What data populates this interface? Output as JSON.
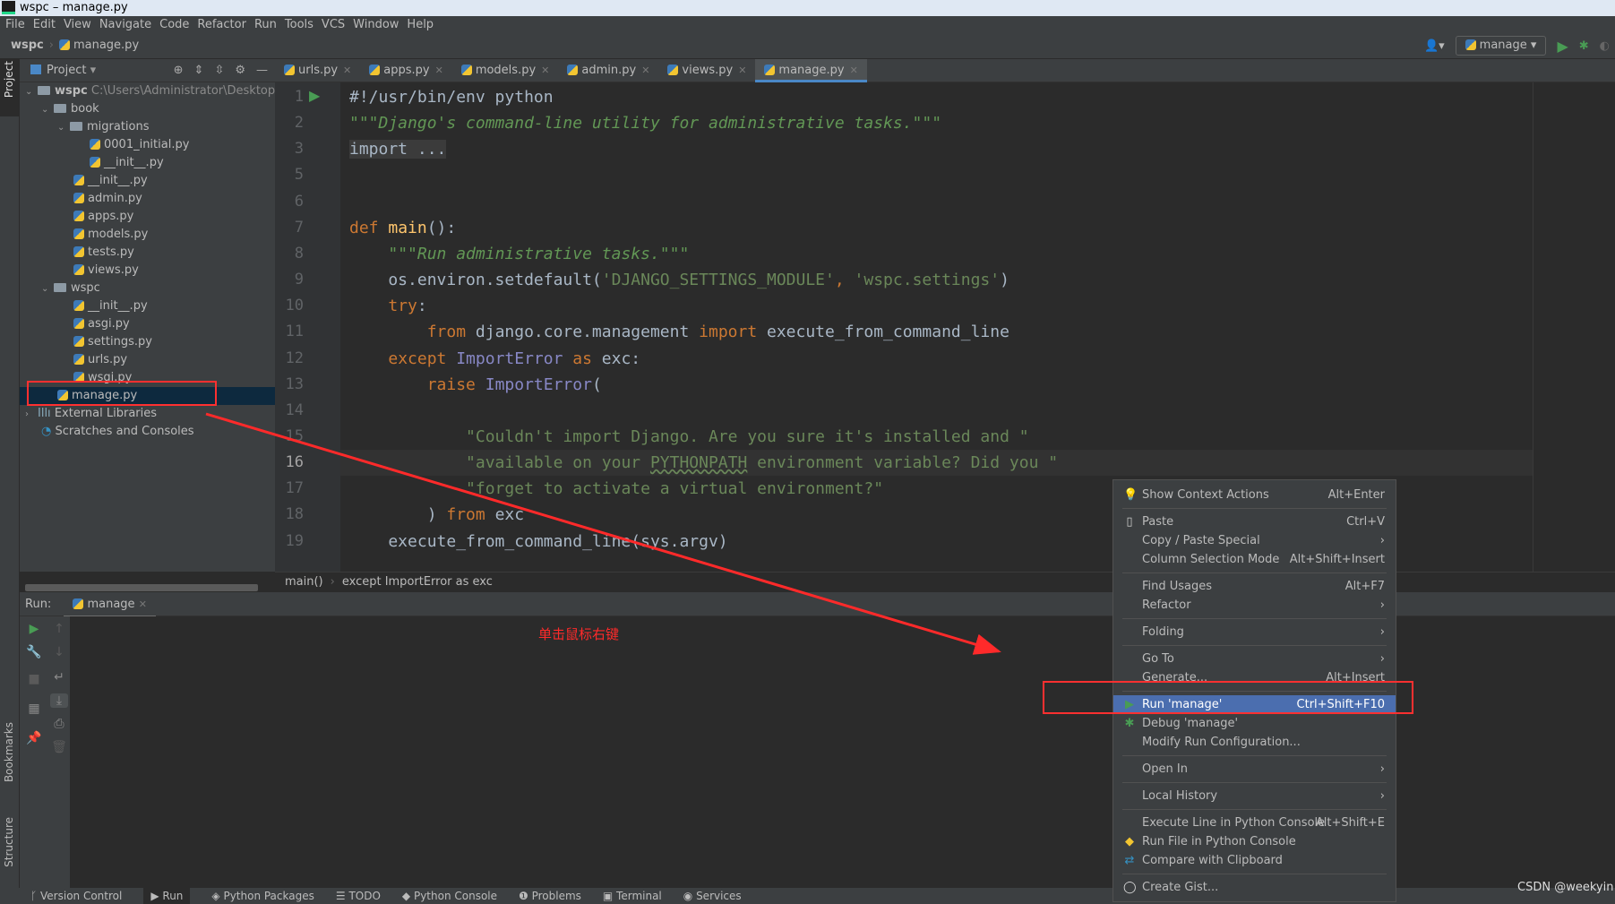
{
  "window": {
    "title": "wspc – manage.py"
  },
  "menubar": [
    "File",
    "Edit",
    "View",
    "Navigate",
    "Code",
    "Refactor",
    "Run",
    "Tools",
    "VCS",
    "Window",
    "Help"
  ],
  "navbar": {
    "project": "wspc",
    "file": "manage.py"
  },
  "toolbar": {
    "run_config": "manage"
  },
  "left_stripe": {
    "project": "Project",
    "bookmarks": "Bookmarks",
    "structure": "Structure"
  },
  "project_panel": {
    "title": "Project"
  },
  "tree": [
    {
      "label": "wspc",
      "path": "C:\\Users\\Administrator\\Desktop\\wspc",
      "type": "root",
      "depth": 0,
      "open": true
    },
    {
      "label": "book",
      "type": "folder",
      "depth": 1,
      "open": true
    },
    {
      "label": "migrations",
      "type": "folder",
      "depth": 2,
      "open": true
    },
    {
      "label": "0001_initial.py",
      "type": "py",
      "depth": 4
    },
    {
      "label": "__init__.py",
      "type": "py",
      "depth": 4
    },
    {
      "label": "__init__.py",
      "type": "py",
      "depth": 3
    },
    {
      "label": "admin.py",
      "type": "py",
      "depth": 3
    },
    {
      "label": "apps.py",
      "type": "py",
      "depth": 3
    },
    {
      "label": "models.py",
      "type": "py",
      "depth": 3
    },
    {
      "label": "tests.py",
      "type": "py",
      "depth": 3
    },
    {
      "label": "views.py",
      "type": "py",
      "depth": 3
    },
    {
      "label": "wspc",
      "type": "folder",
      "depth": 1,
      "open": true
    },
    {
      "label": "__init__.py",
      "type": "py",
      "depth": 3
    },
    {
      "label": "asgi.py",
      "type": "py",
      "depth": 3
    },
    {
      "label": "settings.py",
      "type": "py",
      "depth": 3
    },
    {
      "label": "urls.py",
      "type": "py",
      "depth": 3
    },
    {
      "label": "wsgi.py",
      "type": "py",
      "depth": 3
    },
    {
      "label": "manage.py",
      "type": "py",
      "depth": 2,
      "selected": true
    },
    {
      "label": "External Libraries",
      "type": "lib",
      "depth": 0,
      "open": false
    },
    {
      "label": "Scratches and Consoles",
      "type": "scratch",
      "depth": 1
    }
  ],
  "tabs": [
    {
      "label": "urls.py"
    },
    {
      "label": "apps.py"
    },
    {
      "label": "models.py"
    },
    {
      "label": "admin.py"
    },
    {
      "label": "views.py"
    },
    {
      "label": "manage.py",
      "active": true
    }
  ],
  "code": [
    {
      "n": "1",
      "t": [
        [
          "c",
          "#!/usr/bin/env python"
        ]
      ]
    },
    {
      "n": "2",
      "t": [
        [
          "d",
          "\"\"\"Django's command-line utility for administrative tasks.\"\"\""
        ]
      ]
    },
    {
      "n": "3",
      "t": [
        [
          "c fold",
          "import ..."
        ]
      ]
    },
    {
      "n": "5",
      "t": []
    },
    {
      "n": "6",
      "t": []
    },
    {
      "n": "7",
      "t": [
        [
          "k",
          "def "
        ],
        [
          "f",
          "main"
        ],
        [
          "c",
          "():"
        ]
      ]
    },
    {
      "n": "8",
      "t": [
        [
          "c",
          "    "
        ],
        [
          "d",
          "\"\"\"Run administrative tasks.\"\"\""
        ]
      ]
    },
    {
      "n": "9",
      "t": [
        [
          "c",
          "    os.environ.setdefault("
        ],
        [
          "s",
          "'DJANGO_SETTINGS_MODULE'"
        ],
        [
          "k",
          ", "
        ],
        [
          "s",
          "'wspc.settings'"
        ],
        [
          "c",
          ")"
        ]
      ]
    },
    {
      "n": "10",
      "t": [
        [
          "c",
          "    "
        ],
        [
          "k",
          "try"
        ],
        [
          "c",
          ":"
        ]
      ]
    },
    {
      "n": "11",
      "t": [
        [
          "c",
          "        "
        ],
        [
          "k",
          "from "
        ],
        [
          "c",
          "django.core.management "
        ],
        [
          "k",
          "import "
        ],
        [
          "c",
          "execute_from_command_line"
        ]
      ]
    },
    {
      "n": "12",
      "t": [
        [
          "c",
          "    "
        ],
        [
          "k",
          "except "
        ],
        [
          "b",
          "ImportError "
        ],
        [
          "k",
          "as "
        ],
        [
          "c",
          "exc:"
        ]
      ]
    },
    {
      "n": "13",
      "t": [
        [
          "c",
          "        "
        ],
        [
          "k",
          "raise "
        ],
        [
          "b",
          "ImportError"
        ],
        [
          "c",
          "("
        ]
      ]
    },
    {
      "n": "14",
      "t": []
    },
    {
      "n": "15",
      "t": [
        [
          "c",
          "            "
        ],
        [
          "s",
          "\"Couldn't import Django. Are you sure it's installed and \""
        ]
      ]
    },
    {
      "n": "16",
      "t": [
        [
          "c",
          "            "
        ],
        [
          "s",
          "\"available on your "
        ],
        [
          "s u",
          "PYTHONPATH"
        ],
        [
          "s",
          " environment variable? Did you \""
        ]
      ],
      "current": true
    },
    {
      "n": "17",
      "t": [
        [
          "c",
          "            "
        ],
        [
          "s",
          "\"forget to activate a virtual environment?\""
        ]
      ]
    },
    {
      "n": "18",
      "t": [
        [
          "c",
          "        ) "
        ],
        [
          "k",
          "from "
        ],
        [
          "c",
          "exc"
        ]
      ]
    },
    {
      "n": "19",
      "t": [
        [
          "c",
          "    execute_from_command_line(sys.argv)"
        ]
      ]
    }
  ],
  "breadcrumb": [
    "main()",
    "except ImportError as exc"
  ],
  "run_panel": {
    "label": "Run:",
    "tab": "manage"
  },
  "annotation": "单击鼠标右键",
  "context_menu": [
    {
      "label": "Show Context Actions",
      "shortcut": "Alt+Enter",
      "icon": "lightbulb-icon"
    },
    {
      "sep": true
    },
    {
      "label": "Paste",
      "shortcut": "Ctrl+V",
      "icon": "clipboard-icon"
    },
    {
      "label": "Copy / Paste Special",
      "submenu": true
    },
    {
      "label": "Column Selection Mode",
      "shortcut": "Alt+Shift+Insert"
    },
    {
      "sep": true
    },
    {
      "label": "Find Usages",
      "shortcut": "Alt+F7"
    },
    {
      "label": "Refactor",
      "submenu": true
    },
    {
      "sep": true
    },
    {
      "label": "Folding",
      "submenu": true
    },
    {
      "sep": true
    },
    {
      "label": "Go To",
      "submenu": true
    },
    {
      "label": "Generate...",
      "shortcut": "Alt+Insert"
    },
    {
      "sep": true
    },
    {
      "label": "Run 'manage'",
      "shortcut": "Ctrl+Shift+F10",
      "icon": "run-icon",
      "highlighted": true
    },
    {
      "label": "Debug 'manage'",
      "icon": "debug-icon"
    },
    {
      "label": "Modify Run Configuration..."
    },
    {
      "sep": true
    },
    {
      "label": "Open In",
      "submenu": true
    },
    {
      "sep": true
    },
    {
      "label": "Local History",
      "submenu": true
    },
    {
      "sep": true
    },
    {
      "label": "Execute Line in Python Console",
      "shortcut": "Alt+Shift+E"
    },
    {
      "label": "Run File in Python Console",
      "icon": "python-icon"
    },
    {
      "label": "Compare with Clipboard",
      "icon": "compare-icon"
    },
    {
      "sep": true
    },
    {
      "label": "Create Gist...",
      "icon": "github-icon"
    }
  ],
  "statusbar": [
    "Version Control",
    "Run",
    "Python Packages",
    "TODO",
    "Python Console",
    "Problems",
    "Terminal",
    "Services"
  ],
  "watermark": "CSDN @weekyin",
  "colors": {
    "accent": "#4b6eaf",
    "annotation": "#ff2a2a",
    "run_green": "#499c54"
  }
}
